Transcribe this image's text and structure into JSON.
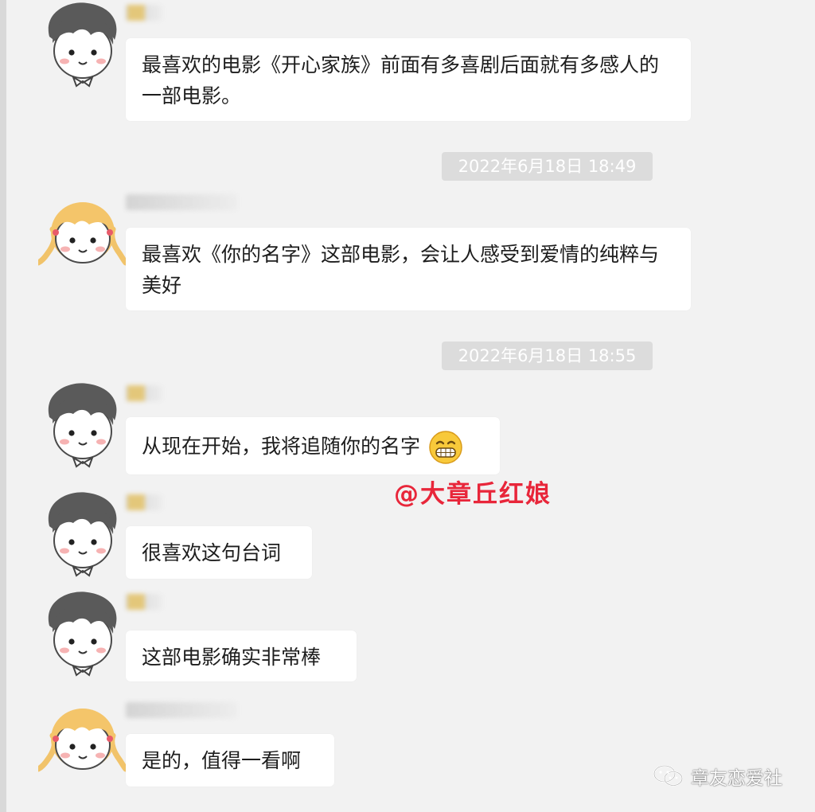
{
  "messages": [
    {
      "text": "最喜欢的电影《开心家族》前面有多喜剧后面就有多感人的一部电影。"
    },
    {
      "text": "最喜欢《你的名字》这部电影，会让人感受到爱情的纯粹与美好"
    },
    {
      "text": "从现在开始，我将追随你的名字"
    },
    {
      "text": "很喜欢这句台词"
    },
    {
      "text": "这部电影确实非常棒"
    },
    {
      "text": "是的，值得一看啊"
    }
  ],
  "timestamps": [
    "2022年6月18日 18:49",
    "2022年6月18日 18:55"
  ],
  "watermarks": {
    "red": "@大章丘红娘",
    "brand": "章友恋爱社"
  },
  "colors": {
    "background": "#f2f2f2",
    "bubble": "#ffffff",
    "timestamp_bg": "#dcdcdc",
    "watermark_red": "#e8263a"
  }
}
